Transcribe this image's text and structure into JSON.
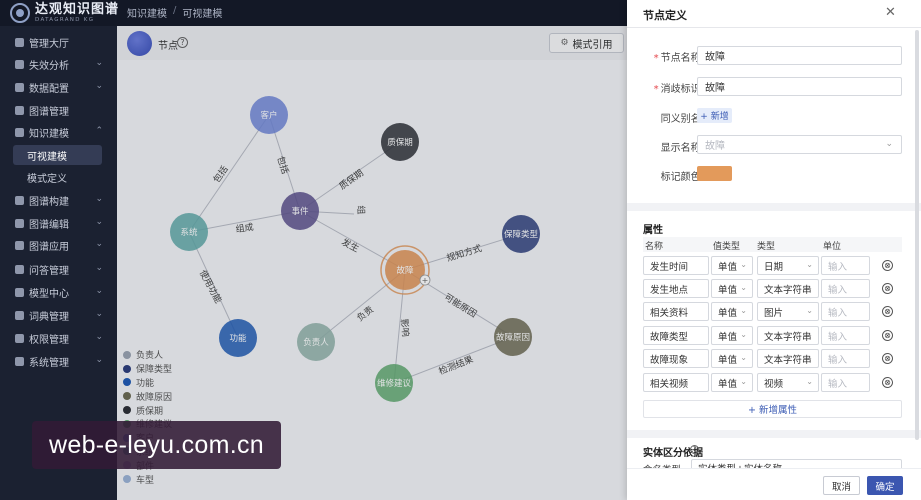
{
  "app": {
    "logo_cn": "达观知识图谱",
    "logo_en": "DATAGRAND KG"
  },
  "breadcrumb": [
    "知识建模",
    "/",
    "可视建模"
  ],
  "sidebar": {
    "items": [
      {
        "label": "管理大厅",
        "has_chevron": false
      },
      {
        "label": "失效分析",
        "has_chevron": true
      },
      {
        "label": "数据配置",
        "has_chevron": true
      },
      {
        "label": "图谱管理",
        "has_chevron": false
      },
      {
        "label": "知识建模",
        "has_chevron": true,
        "expanded": true
      },
      {
        "label": "图谱构建",
        "has_chevron": true
      },
      {
        "label": "图谱编辑",
        "has_chevron": true
      },
      {
        "label": "图谱应用",
        "has_chevron": true
      },
      {
        "label": "问答管理",
        "has_chevron": true
      },
      {
        "label": "模型中心",
        "has_chevron": true
      },
      {
        "label": "词典管理",
        "has_chevron": true
      },
      {
        "label": "权限管理",
        "has_chevron": true
      },
      {
        "label": "系统管理",
        "has_chevron": true
      }
    ],
    "sub_items": [
      {
        "label": "可视建模",
        "active": true
      },
      {
        "label": "模式定义",
        "active": false
      }
    ],
    "chevron_down": "⌄",
    "chevron_up": "⌃"
  },
  "canvas": {
    "node_title": "节点",
    "help_glyph": "?",
    "template_button": "模式引用",
    "template_icon": "⚙",
    "nodes": [
      {
        "id": "n1",
        "label": "客户",
        "color": "#6f86d8"
      },
      {
        "id": "n2",
        "label": "质保期",
        "color": "#2d2f36"
      },
      {
        "id": "n3",
        "label": "事件",
        "color": "#5a4f8c"
      },
      {
        "id": "n4",
        "label": "系统",
        "color": "#5fa8a8"
      },
      {
        "id": "n5",
        "label": "保障类型",
        "color": "#2c3d7c"
      },
      {
        "id": "n6",
        "label": "故障",
        "color": "#e09253",
        "selected": true
      },
      {
        "id": "n7",
        "label": "功能",
        "color": "#1f5bb5"
      },
      {
        "id": "n8",
        "label": "负责人",
        "color": "#8fb0a8"
      },
      {
        "id": "n9",
        "label": "故障原因",
        "color": "#6c6a53"
      },
      {
        "id": "n10",
        "label": "维修建议",
        "color": "#5fa86f"
      }
    ],
    "edges": [
      {
        "label": "包括"
      },
      {
        "label": "包括"
      },
      {
        "label": "质保期"
      },
      {
        "label": "组成"
      },
      {
        "label": "组"
      },
      {
        "label": "发生"
      },
      {
        "label": "使用功能"
      },
      {
        "label": "规知方式"
      },
      {
        "label": "负责"
      },
      {
        "label": "可能原因"
      },
      {
        "label": "影响"
      },
      {
        "label": "检测结果"
      }
    ],
    "legend": [
      {
        "label": "负责人",
        "color": "#9aa3b2"
      },
      {
        "label": "保障类型",
        "color": "#2c3d7c"
      },
      {
        "label": "功能",
        "color": "#1f5bb5"
      },
      {
        "label": "故障原因",
        "color": "#6c6a53"
      },
      {
        "label": "质保期",
        "color": "#2d2f36"
      },
      {
        "label": "维修建议",
        "color": "#5fa86f"
      },
      {
        "label": "客户",
        "color": "#6f86d8"
      },
      {
        "label": "系统",
        "color": "#5fa8a8"
      },
      {
        "label": "部件",
        "color": "#b6a6d9"
      },
      {
        "label": "车型",
        "color": "#9bb3d6"
      }
    ]
  },
  "watermark": "web-e-leyu.com.cn",
  "drawer": {
    "title": "节点定义",
    "close_icon": "✕",
    "form": {
      "name_label": "节点名称:",
      "name_value": "故障",
      "disambig_label": "消歧标识:",
      "disambig_value": "故障",
      "alias_label": "同义别名:",
      "alias_add": "+ 新增",
      "display_label": "显示名称:",
      "display_placeholder": "故障",
      "color_label": "标记颜色:",
      "marker_color": "#e39a5b",
      "required_mark": "*"
    },
    "attributes": {
      "title": "属性",
      "headers": [
        "名称",
        "值类型",
        "类型",
        "单位"
      ],
      "rows": [
        {
          "name": "发生时间",
          "value_type": "单值",
          "type": "日期",
          "unit": "输入"
        },
        {
          "name": "发生地点",
          "value_type": "单值",
          "type": "文本字符串",
          "unit": "输入"
        },
        {
          "name": "相关资料",
          "value_type": "单值",
          "type": "图片",
          "unit": "输入"
        },
        {
          "name": "故障类型",
          "value_type": "单值",
          "type": "文本字符串",
          "unit": "输入"
        },
        {
          "name": "故障现象",
          "value_type": "单值",
          "type": "文本字符串",
          "unit": "输入"
        },
        {
          "name": "相关视频",
          "value_type": "单值",
          "type": "视频",
          "unit": "输入"
        }
      ],
      "delete_glyph": "⊗",
      "add_label": "+ 新增属性"
    },
    "entity": {
      "title": "实体区分依据",
      "help_glyph": "?",
      "label": "命名类型:",
      "value": "实体类型+实体名称"
    },
    "cancel_label": "取消",
    "ok_label": "确定"
  }
}
